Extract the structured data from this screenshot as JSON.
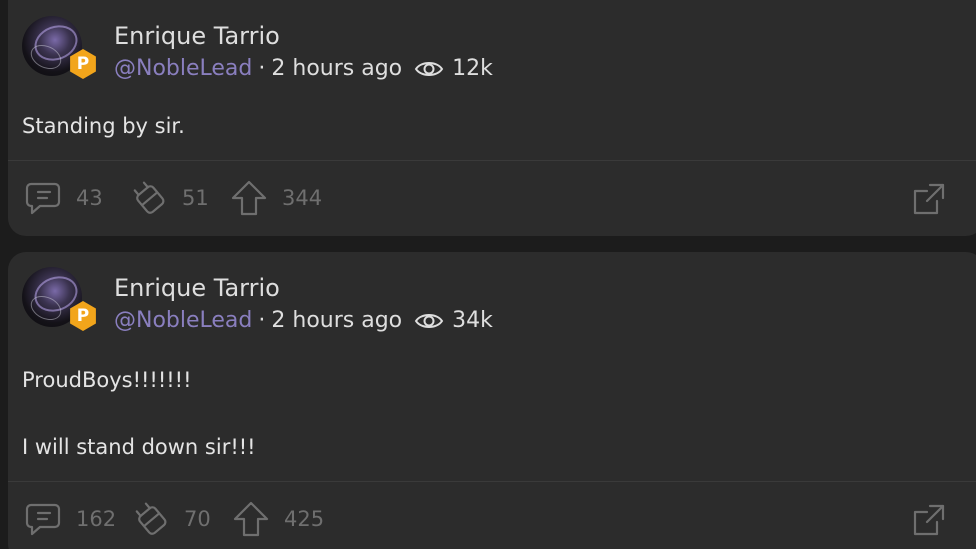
{
  "posts": [
    {
      "author": "Enrique Tarrio",
      "handle": "@NobleLead",
      "separator": "·",
      "time": "2 hours ago",
      "views": "12k",
      "badge_letter": "P",
      "lines": [
        "Standing by sir."
      ],
      "comments": "43",
      "reposts": "51",
      "upvotes": "344"
    },
    {
      "author": "Enrique Tarrio",
      "handle": "@NobleLead",
      "separator": "·",
      "time": "2 hours ago",
      "views": "34k",
      "badge_letter": "P",
      "lines": [
        "ProudBoys!!!!!!!",
        "I will stand down sir!!!"
      ],
      "comments": "162",
      "reposts": "70",
      "upvotes": "425"
    }
  ],
  "icons": {
    "comment": "comment-icon",
    "repost": "repost-icon",
    "upvote": "upvote-icon",
    "views": "eye-icon",
    "expand": "expand-icon",
    "badge": "badge-icon"
  },
  "colors": {
    "background": "#1c1c1c",
    "card": "#2c2c2c",
    "handle": "#8a7fbf",
    "badge": "#f2a51b",
    "action": "#6f6f6f"
  }
}
